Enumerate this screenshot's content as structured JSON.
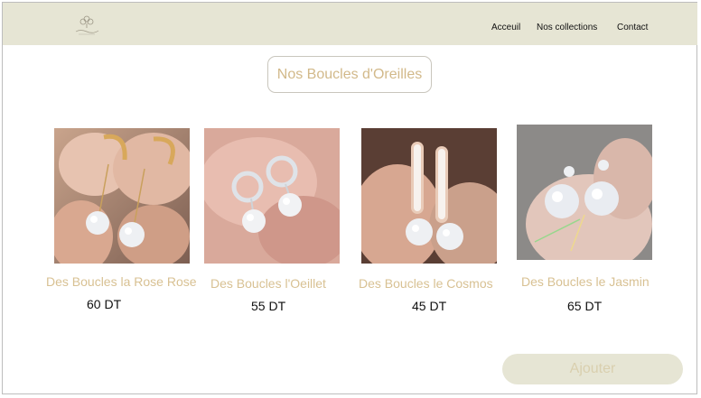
{
  "header": {
    "logo_icon": "earring-logo-icon",
    "nav": [
      "Acceuil",
      "Nos collections",
      "Contact"
    ]
  },
  "main": {
    "title": "Nos Boucles d'Oreilles",
    "products": [
      {
        "name": "Des Boucles la Rose Rose",
        "price": "60 DT",
        "image_icon": "hoop-drop-earrings-photo"
      },
      {
        "name": "Des Boucles l'Oeillet",
        "price": "55 DT",
        "image_icon": "circle-stud-earrings-photo"
      },
      {
        "name": "Des Boucles le Cosmos",
        "price": "45 DT",
        "image_icon": "pave-hoop-earrings-photo"
      },
      {
        "name": "Des Boucles le Jasmin",
        "price": "65 DT",
        "image_icon": "crystal-drop-earrings-photo"
      }
    ],
    "add_label": "Ajouter"
  },
  "colors": {
    "header_bg": "#e6e5d4",
    "accent_text": "#d8c193",
    "button_bg": "#e6e5d4"
  }
}
